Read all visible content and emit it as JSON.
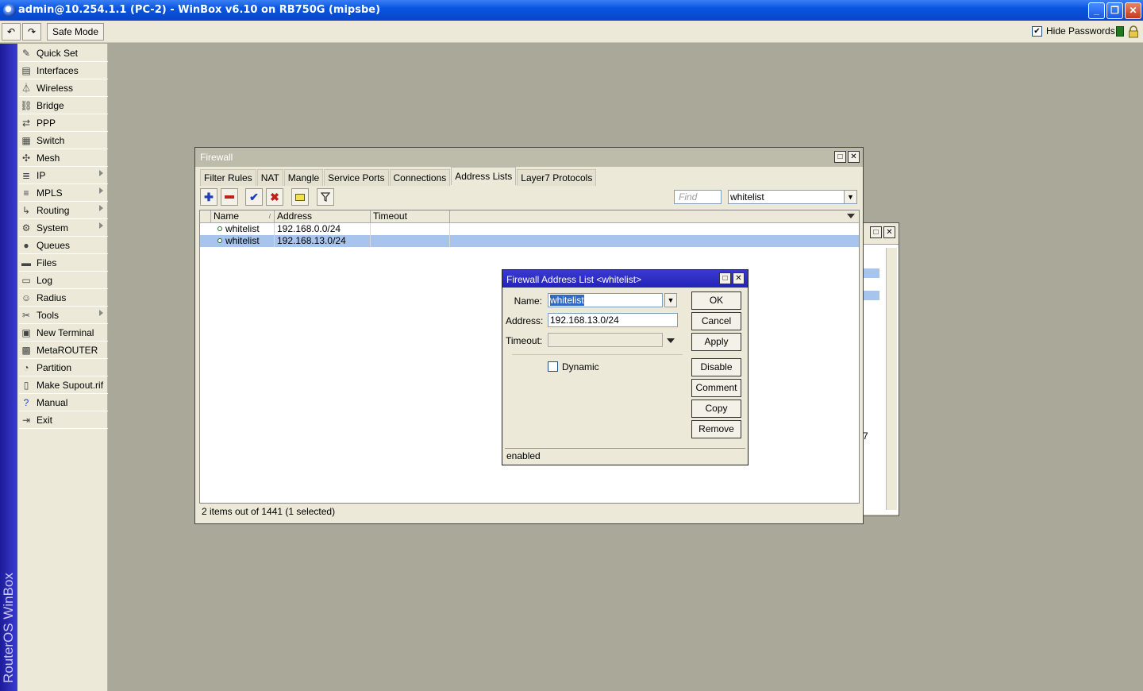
{
  "window": {
    "title": "admin@10.254.1.1 (PC-2) - WinBox v6.10 on RB750G (mipsbe)"
  },
  "toolbar": {
    "safe_mode": "Safe Mode",
    "hide_passwords": "Hide Passwords"
  },
  "banner": {
    "text": "RouterOS WinBox"
  },
  "menu": {
    "items": [
      {
        "label": "Quick Set",
        "icon": "magic-wand-icon"
      },
      {
        "label": "Interfaces",
        "icon": "interfaces-icon"
      },
      {
        "label": "Wireless",
        "icon": "antenna-icon"
      },
      {
        "label": "Bridge",
        "icon": "bridge-icon"
      },
      {
        "label": "PPP",
        "icon": "ppp-icon"
      },
      {
        "label": "Switch",
        "icon": "switch-icon"
      },
      {
        "label": "Mesh",
        "icon": "mesh-icon"
      },
      {
        "label": "IP",
        "icon": "ip-icon"
      },
      {
        "label": "MPLS",
        "icon": "mpls-icon"
      },
      {
        "label": "Routing",
        "icon": "routing-icon"
      },
      {
        "label": "System",
        "icon": "gear-icon"
      },
      {
        "label": "Queues",
        "icon": "queues-icon"
      },
      {
        "label": "Files",
        "icon": "folder-icon"
      },
      {
        "label": "Log",
        "icon": "log-icon"
      },
      {
        "label": "Radius",
        "icon": "users-icon"
      },
      {
        "label": "Tools",
        "icon": "tools-icon"
      },
      {
        "label": "New Terminal",
        "icon": "terminal-icon"
      },
      {
        "label": "MetaROUTER",
        "icon": "metarouter-icon"
      },
      {
        "label": "Partition",
        "icon": "pie-icon"
      },
      {
        "label": "Make Supout.rif",
        "icon": "document-icon"
      },
      {
        "label": "Manual",
        "icon": "help-icon"
      },
      {
        "label": "Exit",
        "icon": "exit-icon"
      }
    ]
  },
  "firewall": {
    "title": "Firewall",
    "tabs": [
      "Filter Rules",
      "NAT",
      "Mangle",
      "Service Ports",
      "Connections",
      "Address Lists",
      "Layer7 Protocols"
    ],
    "active_tab": "Address Lists",
    "find_placeholder": "Find",
    "list_filter": "whitelist",
    "columns": [
      "Name",
      "Address",
      "Timeout"
    ],
    "rows": [
      {
        "name": "whitelist",
        "address": "192.168.0.0/24",
        "timeout": ""
      },
      {
        "name": "whitelist",
        "address": "192.168.13.0/24",
        "timeout": ""
      }
    ],
    "status": "2 items out of 1441 (1 selected)"
  },
  "dialog": {
    "title": "Firewall Address List <whitelist>",
    "name_label": "Name:",
    "name_value": "whitelist",
    "address_label": "Address:",
    "address_value": "192.168.13.0/24",
    "timeout_label": "Timeout:",
    "dynamic_label": "Dynamic",
    "buttons": {
      "ok": "OK",
      "cancel": "Cancel",
      "apply": "Apply",
      "disable": "Disable",
      "comment": "Comment",
      "copy": "Copy",
      "remove": "Remove"
    },
    "status": "enabled"
  },
  "background_window": {
    "fragment": "7"
  },
  "colors": {
    "titlebar": "#0a55e0",
    "selection": "#a6c4ec",
    "dialog_title": "#2323b8"
  }
}
